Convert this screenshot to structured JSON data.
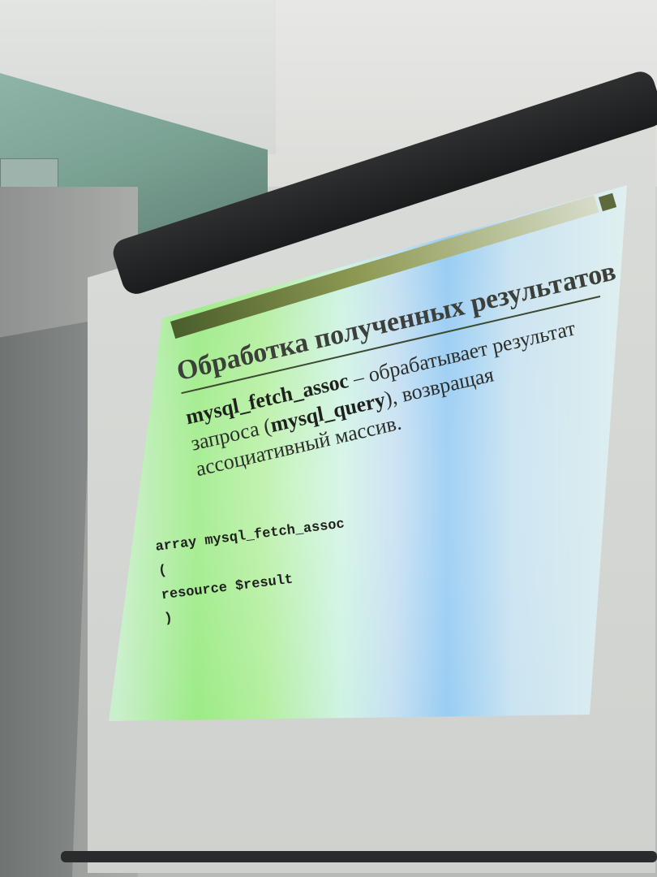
{
  "slide": {
    "title": "Обработка полученных результатов",
    "body": {
      "function_name": "mysql_fetch_assoc",
      "text_1": " – обрабатывает результат запроса (",
      "query_name": "mysql_query",
      "text_2": "), возвращая ассоциативный массив."
    },
    "code": {
      "line_1": "array mysql_fetch_assoc",
      "line_2": "(",
      "line_3": "resource $result",
      "line_4": ")"
    }
  }
}
